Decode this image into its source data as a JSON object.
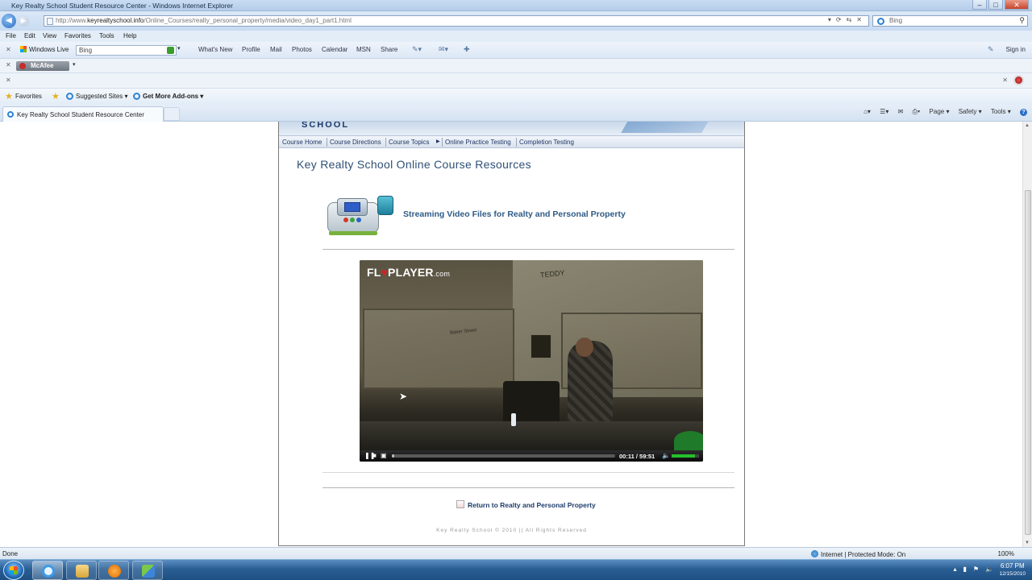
{
  "window": {
    "title": "Key Realty School Student Resource Center - Windows Internet Explorer",
    "buttons": [
      "–",
      "□",
      "✕"
    ]
  },
  "address": {
    "url_prefix": "http://www.",
    "url_host": "keyrealtyschool.info",
    "url_path": "/Online_Courses/realty_personal_property/media/video_day1_part1.html",
    "search_placeholder": "Bing"
  },
  "menu": [
    "File",
    "Edit",
    "View",
    "Favorites",
    "Tools",
    "Help"
  ],
  "live_toolbar": {
    "brand": "Windows Live",
    "search_value": "Bing",
    "links": [
      "What's New",
      "Profile",
      "Mail",
      "Photos",
      "Calendar",
      "MSN",
      "Share"
    ],
    "signin": "Sign in"
  },
  "mcafee": {
    "label": "McAfee"
  },
  "favorites_bar": {
    "favorites": "Favorites",
    "suggested": "Suggested Sites ▾",
    "addons": "Get More Add-ons ▾"
  },
  "tab": {
    "title": "Key Realty School Student Resource Center"
  },
  "command_bar": {
    "page": "Page ▾",
    "safety": "Safety ▾",
    "tools": "Tools ▾",
    "help": "?"
  },
  "site": {
    "banner_text": "SCHOOL",
    "nav": [
      "Course Home",
      "Course Directions",
      "Course Topics",
      "Online Practice Testing",
      "Completion Testing"
    ],
    "heading": "Key Realty School Online Course Resources",
    "section_title": "Streaming Video Files for Realty and Personal Property",
    "return_link": "Return to Realty and Personal Property",
    "footer": "Key Realty School © 2010 || All Rights Reserved"
  },
  "player": {
    "brand_fl": "FL",
    "brand_heart": "♥",
    "brand_player": "PLAYER",
    "brand_com": ".com",
    "time": "00:11 / 59:51",
    "progress": 0.003,
    "volume": 0.85,
    "scene_text": [
      "TEDDY",
      "Baker Street"
    ]
  },
  "status": {
    "left": "Done",
    "zone": "Internet | Protected Mode: On",
    "zoom": "100%"
  },
  "taskbar": {
    "time": "6:07 PM",
    "date": "12/15/2010"
  }
}
